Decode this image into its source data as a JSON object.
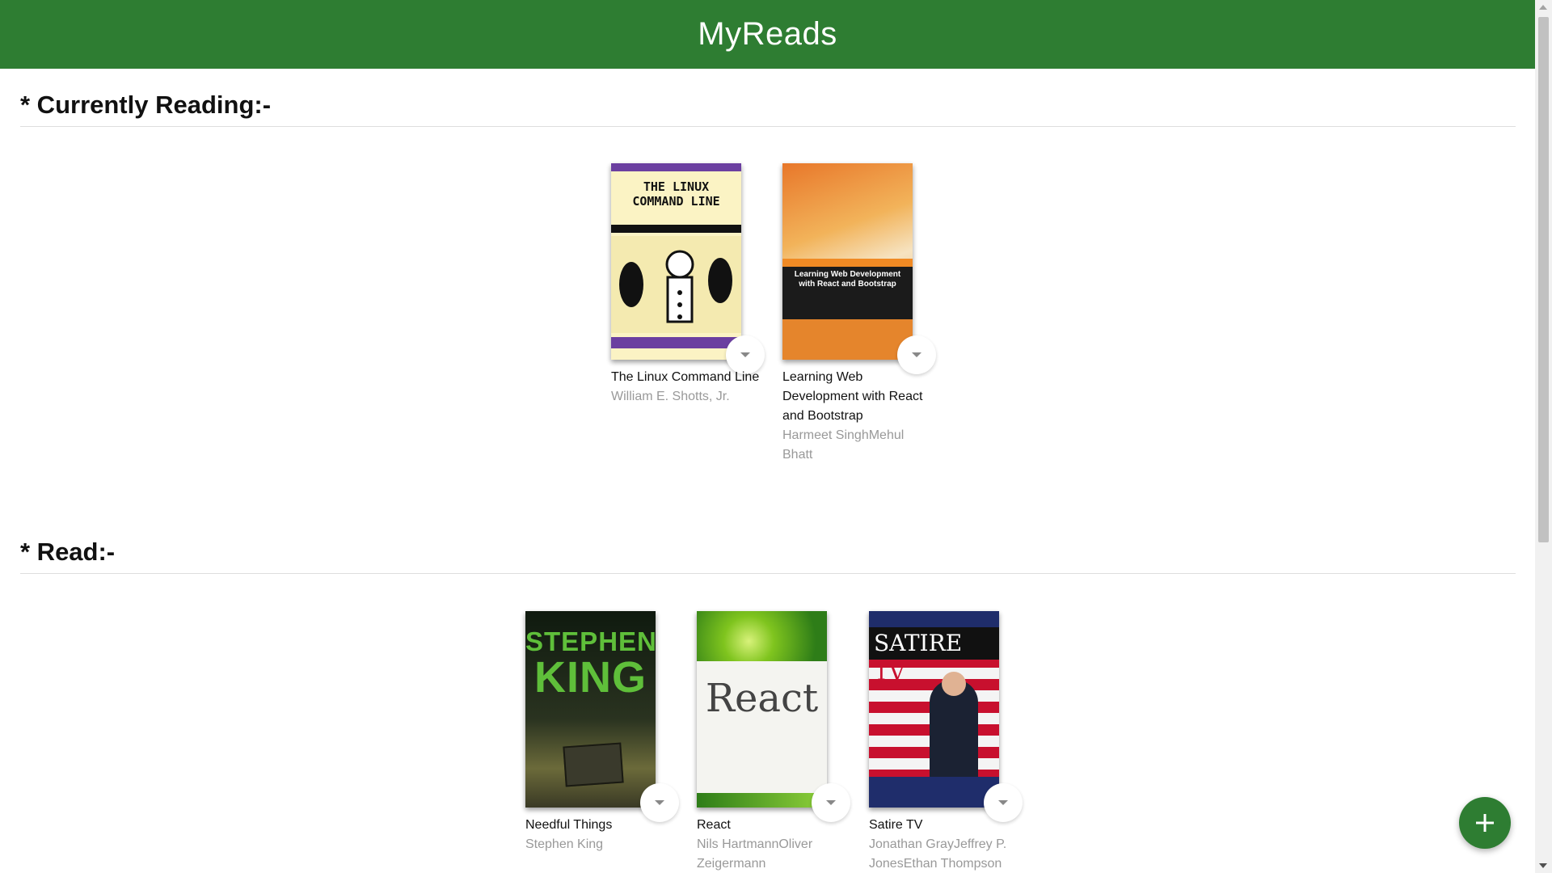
{
  "app": {
    "title": "MyReads"
  },
  "colors": {
    "header": "#2e7d32",
    "fab": "#2e7d32"
  },
  "shelves": [
    {
      "title": "* Currently Reading:-",
      "books": [
        {
          "title": "The Linux Command Line",
          "authors": "William E. Shotts, Jr.",
          "cover_text": [
            "THE LINUX",
            "COMMAND LINE"
          ]
        },
        {
          "title": "Learning Web Development with React and Bootstrap",
          "authors": "Harmeet SinghMehul Bhatt",
          "cover_text": [
            "Learning Web Development",
            "with React and Bootstrap"
          ]
        }
      ]
    },
    {
      "title": "* Read:-",
      "books": [
        {
          "title": "Needful Things",
          "authors": "Stephen King",
          "cover_text": [
            "STEPHEN",
            "KING"
          ]
        },
        {
          "title": "React",
          "authors": "Nils HartmannOliver Zeigermann",
          "cover_text": [
            "React"
          ]
        },
        {
          "title": "Satire TV",
          "authors": "Jonathan GrayJeffrey P. JonesEthan Thompson",
          "cover_text": [
            "SATIRE",
            "TV"
          ]
        }
      ]
    }
  ],
  "icons": {
    "fab": "plus-icon",
    "shelf_changer": "chevron-down-icon"
  }
}
